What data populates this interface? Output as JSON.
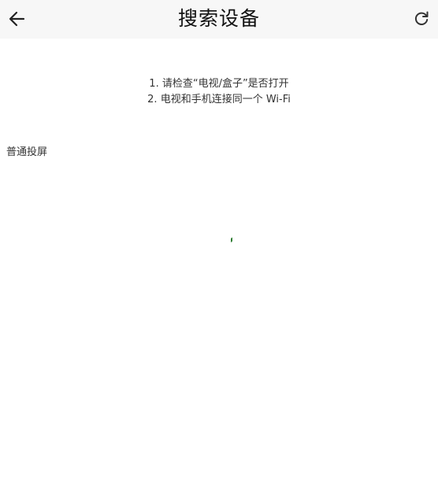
{
  "header": {
    "title": "搜索设备",
    "back_icon": "arrow-left-icon",
    "refresh_icon": "refresh-icon"
  },
  "tips": [
    "1. 请检查“电视/盒子”是否打开",
    "2. 电视和手机连接同一个 Wi-Fi"
  ],
  "section": {
    "label": "普通投屏"
  },
  "loading": {
    "icon": "loading-spinner-icon",
    "color": "#2e7d32"
  }
}
